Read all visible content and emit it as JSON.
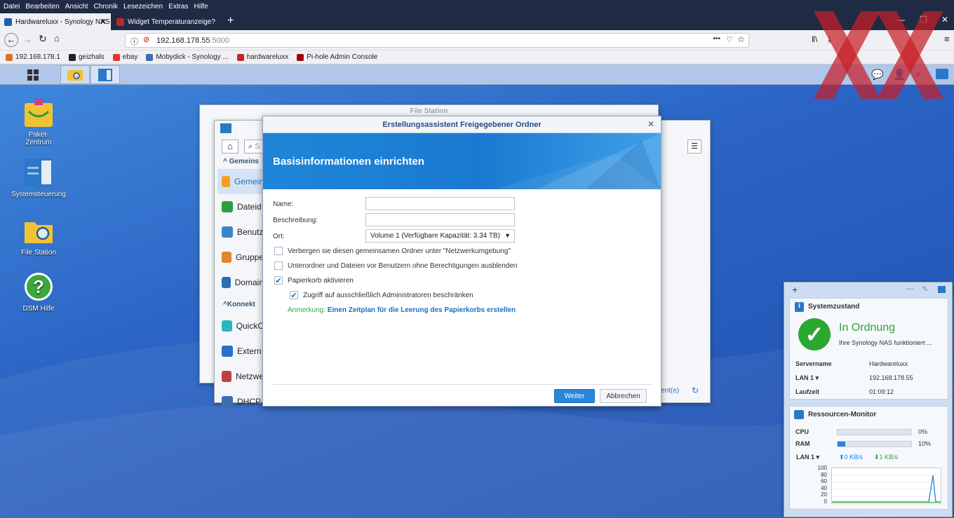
{
  "browser": {
    "menu": [
      "Datei",
      "Bearbeiten",
      "Ansicht",
      "Chronik",
      "Lesezeichen",
      "Extras",
      "Hilfe"
    ],
    "tabs": [
      {
        "label": "Hardwareluxx - Synology NAS",
        "active": true
      },
      {
        "label": "Widget Temperaturanzeige?",
        "active": false
      }
    ],
    "new_tab": "+",
    "url_host": "192.168.178.55",
    "url_port": ":5000",
    "bookmarks": [
      {
        "label": "192.168.178.1",
        "color": "#e07020"
      },
      {
        "label": "geizhals",
        "color": "#222222"
      },
      {
        "label": "ebay",
        "color": "#e53238"
      },
      {
        "label": "Mobydick - Synology ...",
        "color": "#3a6fb0"
      },
      {
        "label": "hardwareluxx",
        "color": "#c0262d"
      },
      {
        "label": "Pi-hole Admin Console",
        "color": "#96060c"
      }
    ],
    "menu_dots": "•••"
  },
  "desktop": {
    "icons": [
      {
        "label": "Paket-\nZentrum",
        "icon": "package-center-icon"
      },
      {
        "label": "Systemsteuerung",
        "icon": "control-panel-icon"
      },
      {
        "label": "File Station",
        "icon": "file-station-icon"
      },
      {
        "label": "DSM Hilfe",
        "icon": "help-icon"
      }
    ]
  },
  "file_station": {
    "title": "File Station",
    "section_shared": "Gemeins",
    "section_connect": "Konnekt",
    "sidebar": [
      "Gemein",
      "Dateid",
      "Benutz",
      "Gruppe",
      "Domain",
      "QuickC",
      "Extern",
      "Netzwe",
      "DHCP-"
    ],
    "footer_link": "ent(e)",
    "search_placeholder": "S"
  },
  "wizard": {
    "title": "Erstellungsassistent Freigegebener Ordner",
    "heading": "Basisinformationen einrichten",
    "name_label": "Name:",
    "name_value": "",
    "desc_label": "Beschreibung:",
    "desc_value": "",
    "location_label": "Ort:",
    "location_value": "Volume 1 (Verfügbare Kapazität:  3.34 TB)",
    "opt_hide": "Verbergen sie diesen gemeinsamen Ordner unter \"Netzwerkumgebung\"",
    "opt_hide_checked": false,
    "opt_subfolders": "Unterordner und Dateien vor Benutzern ohne Berechtigungen ausblenden",
    "opt_subfolders_checked": false,
    "opt_recycle": "Papierkorb aktivieren",
    "opt_recycle_checked": true,
    "opt_admin": "Zugriff auf ausschließlich Administratoren beschränken",
    "opt_admin_checked": true,
    "note_label": "Anmerkung:",
    "note_link": "Einen Zeitplan für die Leerung des Papierkorbs erstellen",
    "btn_next": "Weiter",
    "btn_cancel": "Abbrechen"
  },
  "widget": {
    "add": "+",
    "health_title": "Systemzustand",
    "health_status": "In Ordnung",
    "health_desc": "Ihre Synology NAS funktioniert ...",
    "rows": [
      {
        "k": "Servername",
        "v": "Hardwareluxx"
      },
      {
        "k": "LAN 1 ▾",
        "v": "192.168.178.55"
      },
      {
        "k": "Laufzeit",
        "v": "01:09:12"
      }
    ],
    "res_title": "Ressourcen-Monitor",
    "cpu_label": "CPU",
    "cpu_pct": "0%",
    "cpu_value": 0,
    "ram_label": "RAM",
    "ram_pct": "10%",
    "ram_value": 10,
    "lan_label": "LAN 1 ▾",
    "up": "0 KB/s",
    "down": "1 KB/s",
    "yticks": [
      "100",
      "80",
      "60",
      "40",
      "20",
      "0"
    ],
    "colors": {
      "ok": "#2aa830",
      "accent": "#2a86d8",
      "up": "#1a7fd8",
      "down": "#2aa830"
    }
  }
}
